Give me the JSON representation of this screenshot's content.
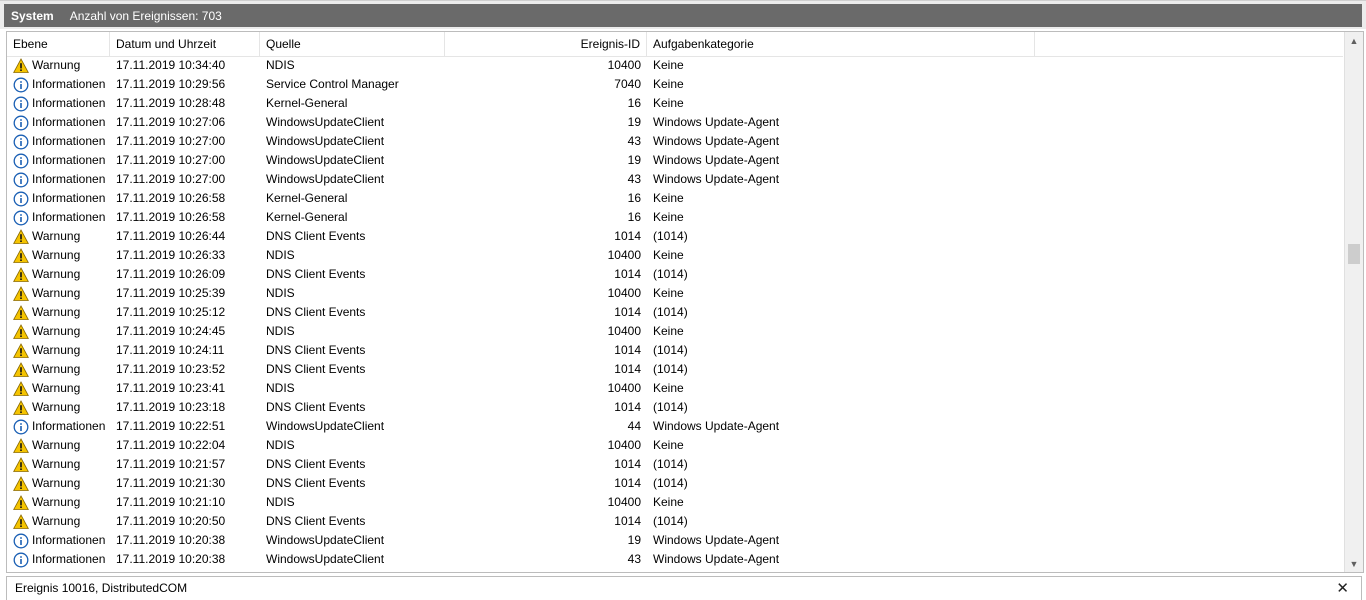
{
  "window": {
    "title": "System",
    "event_count": "Anzahl von Ereignissen: 703"
  },
  "columns": {
    "level": "Ebene",
    "datetime": "Datum und Uhrzeit",
    "source": "Quelle",
    "event_id": "Ereignis-ID",
    "category": "Aufgabenkategorie"
  },
  "events": [
    {
      "level": "Warnung",
      "type": "warning",
      "datetime": "17.11.2019 10:34:40",
      "source": "NDIS",
      "event_id": "10400",
      "category": "Keine"
    },
    {
      "level": "Informationen",
      "type": "info",
      "datetime": "17.11.2019 10:29:56",
      "source": "Service Control Manager",
      "event_id": "7040",
      "category": "Keine"
    },
    {
      "level": "Informationen",
      "type": "info",
      "datetime": "17.11.2019 10:28:48",
      "source": "Kernel-General",
      "event_id": "16",
      "category": "Keine"
    },
    {
      "level": "Informationen",
      "type": "info",
      "datetime": "17.11.2019 10:27:06",
      "source": "WindowsUpdateClient",
      "event_id": "19",
      "category": "Windows Update-Agent"
    },
    {
      "level": "Informationen",
      "type": "info",
      "datetime": "17.11.2019 10:27:00",
      "source": "WindowsUpdateClient",
      "event_id": "43",
      "category": "Windows Update-Agent"
    },
    {
      "level": "Informationen",
      "type": "info",
      "datetime": "17.11.2019 10:27:00",
      "source": "WindowsUpdateClient",
      "event_id": "19",
      "category": "Windows Update-Agent"
    },
    {
      "level": "Informationen",
      "type": "info",
      "datetime": "17.11.2019 10:27:00",
      "source": "WindowsUpdateClient",
      "event_id": "43",
      "category": "Windows Update-Agent"
    },
    {
      "level": "Informationen",
      "type": "info",
      "datetime": "17.11.2019 10:26:58",
      "source": "Kernel-General",
      "event_id": "16",
      "category": "Keine"
    },
    {
      "level": "Informationen",
      "type": "info",
      "datetime": "17.11.2019 10:26:58",
      "source": "Kernel-General",
      "event_id": "16",
      "category": "Keine"
    },
    {
      "level": "Warnung",
      "type": "warning",
      "datetime": "17.11.2019 10:26:44",
      "source": "DNS Client Events",
      "event_id": "1014",
      "category": "(1014)"
    },
    {
      "level": "Warnung",
      "type": "warning",
      "datetime": "17.11.2019 10:26:33",
      "source": "NDIS",
      "event_id": "10400",
      "category": "Keine"
    },
    {
      "level": "Warnung",
      "type": "warning",
      "datetime": "17.11.2019 10:26:09",
      "source": "DNS Client Events",
      "event_id": "1014",
      "category": "(1014)"
    },
    {
      "level": "Warnung",
      "type": "warning",
      "datetime": "17.11.2019 10:25:39",
      "source": "NDIS",
      "event_id": "10400",
      "category": "Keine"
    },
    {
      "level": "Warnung",
      "type": "warning",
      "datetime": "17.11.2019 10:25:12",
      "source": "DNS Client Events",
      "event_id": "1014",
      "category": "(1014)"
    },
    {
      "level": "Warnung",
      "type": "warning",
      "datetime": "17.11.2019 10:24:45",
      "source": "NDIS",
      "event_id": "10400",
      "category": "Keine"
    },
    {
      "level": "Warnung",
      "type": "warning",
      "datetime": "17.11.2019 10:24:11",
      "source": "DNS Client Events",
      "event_id": "1014",
      "category": "(1014)"
    },
    {
      "level": "Warnung",
      "type": "warning",
      "datetime": "17.11.2019 10:23:52",
      "source": "DNS Client Events",
      "event_id": "1014",
      "category": "(1014)"
    },
    {
      "level": "Warnung",
      "type": "warning",
      "datetime": "17.11.2019 10:23:41",
      "source": "NDIS",
      "event_id": "10400",
      "category": "Keine"
    },
    {
      "level": "Warnung",
      "type": "warning",
      "datetime": "17.11.2019 10:23:18",
      "source": "DNS Client Events",
      "event_id": "1014",
      "category": "(1014)"
    },
    {
      "level": "Informationen",
      "type": "info",
      "datetime": "17.11.2019 10:22:51",
      "source": "WindowsUpdateClient",
      "event_id": "44",
      "category": "Windows Update-Agent"
    },
    {
      "level": "Warnung",
      "type": "warning",
      "datetime": "17.11.2019 10:22:04",
      "source": "NDIS",
      "event_id": "10400",
      "category": "Keine"
    },
    {
      "level": "Warnung",
      "type": "warning",
      "datetime": "17.11.2019 10:21:57",
      "source": "DNS Client Events",
      "event_id": "1014",
      "category": "(1014)"
    },
    {
      "level": "Warnung",
      "type": "warning",
      "datetime": "17.11.2019 10:21:30",
      "source": "DNS Client Events",
      "event_id": "1014",
      "category": "(1014)"
    },
    {
      "level": "Warnung",
      "type": "warning",
      "datetime": "17.11.2019 10:21:10",
      "source": "NDIS",
      "event_id": "10400",
      "category": "Keine"
    },
    {
      "level": "Warnung",
      "type": "warning",
      "datetime": "17.11.2019 10:20:50",
      "source": "DNS Client Events",
      "event_id": "1014",
      "category": "(1014)"
    },
    {
      "level": "Informationen",
      "type": "info",
      "datetime": "17.11.2019 10:20:38",
      "source": "WindowsUpdateClient",
      "event_id": "19",
      "category": "Windows Update-Agent"
    },
    {
      "level": "Informationen",
      "type": "info",
      "datetime": "17.11.2019 10:20:38",
      "source": "WindowsUpdateClient",
      "event_id": "43",
      "category": "Windows Update-Agent"
    }
  ],
  "footer": {
    "selected_event": "Ereignis 10016, DistributedCOM",
    "close_symbol": "✕"
  },
  "icons": {
    "warning": "warning-icon",
    "info": "info-icon"
  },
  "colors": {
    "titlebar": "#6a6a6a",
    "warning_fill": "#f5c400",
    "info_ring": "#1a5fb4"
  }
}
